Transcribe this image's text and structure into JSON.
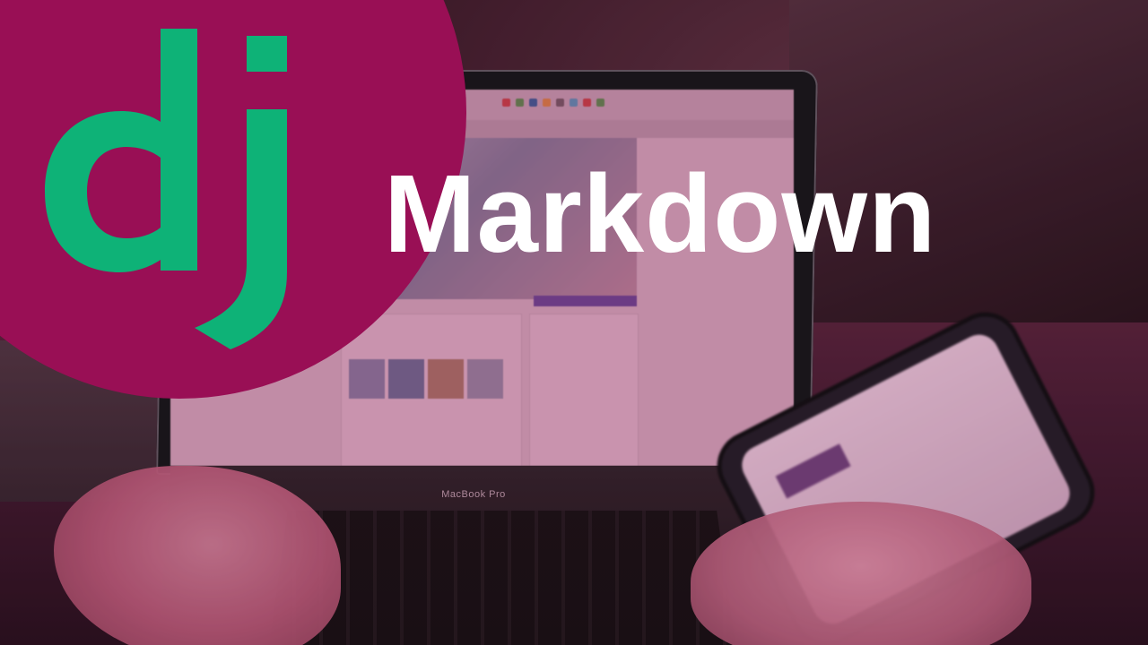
{
  "logo": {
    "icon": "django-dj-icon",
    "circle_color": "#990f55",
    "glyph_color": "#0eb277"
  },
  "title": {
    "text": "Markdown",
    "color": "#ffffff"
  },
  "photo": {
    "laptop_brand": "MacBook Pro",
    "overlay_color": "#8c1450"
  }
}
